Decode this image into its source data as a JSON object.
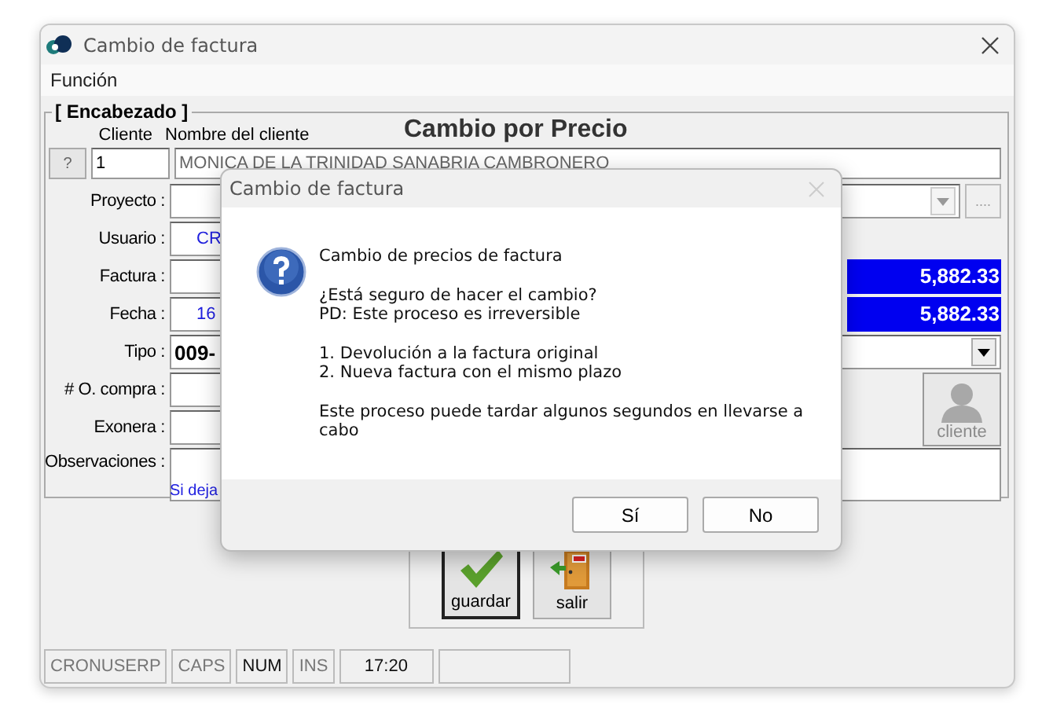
{
  "window": {
    "title": "Cambio de factura"
  },
  "menu": [
    "Función"
  ],
  "header": {
    "group_title": "[ Encabezado ]",
    "client_label": "Cliente",
    "name_label": "Nombre del cliente",
    "heading": "Cambio por Precio",
    "help_button": "?",
    "client_id": "1",
    "client_name": "MONICA DE LA TRINIDAD SANABRIA CAMBRONERO"
  },
  "fields": [
    {
      "label": "Proyecto :",
      "kind": "combo",
      "button": "...."
    },
    {
      "label": "Usuario :",
      "kind": "text",
      "value": "CR"
    },
    {
      "label": "Factura :",
      "kind": "text",
      "amount": "5,882.33"
    },
    {
      "label": "Fecha :",
      "kind": "text",
      "value": "16",
      "amount": "5,882.33"
    },
    {
      "label": "Tipo :",
      "kind": "dropdown",
      "value": "009-"
    },
    {
      "label": "# O. compra :",
      "kind": "text"
    },
    {
      "label": "Exonera :",
      "kind": "text"
    },
    {
      "label": "Observaciones :",
      "kind": "memo",
      "note": "Si deja"
    }
  ],
  "client_button": {
    "label": "cliente",
    "disabled": true
  },
  "actions": [
    {
      "label": "guardar",
      "kind": "save",
      "selected": true
    },
    {
      "label": "salir",
      "kind": "exit",
      "selected": false
    }
  ],
  "status_bar": [
    {
      "text": "CRONUSERP",
      "on": false
    },
    {
      "text": "CAPS",
      "on": false
    },
    {
      "text": "NUM",
      "on": true
    },
    {
      "text": "INS",
      "on": false
    },
    {
      "text": "17:20",
      "on": true
    }
  ],
  "dialog": {
    "title": "Cambio de factura",
    "paragraphs": [
      [
        "Cambio de precios de factura"
      ],
      [
        "¿Está seguro de hacer el cambio?",
        "PD: Este proceso es irreversible"
      ],
      [
        "1. Devolución a la factura original",
        "2. Nueva factura con el mismo plazo"
      ],
      [
        "Este proceso puede tardar algunos segundos en llevarse a cabo"
      ]
    ],
    "buttons": [
      "Sí",
      "No"
    ]
  }
}
